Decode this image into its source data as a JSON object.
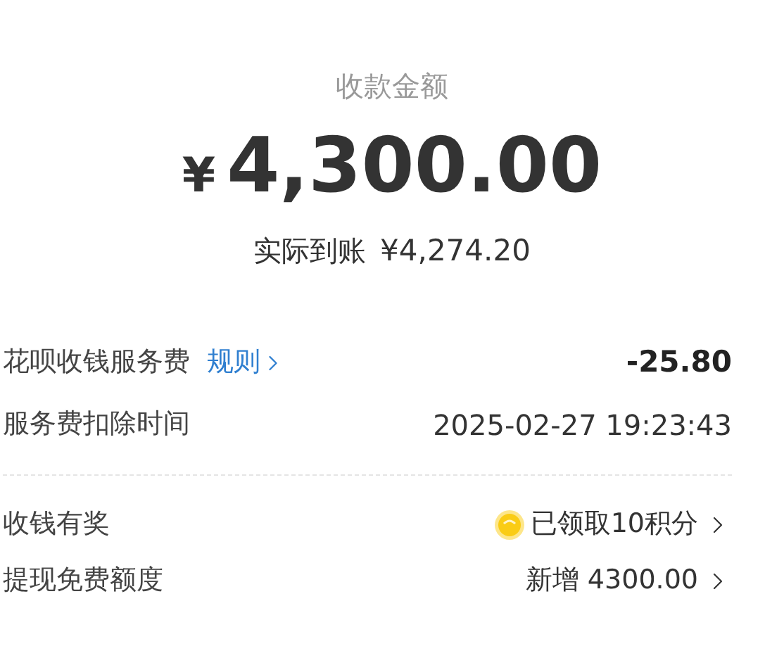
{
  "header": {
    "title": "收款金额",
    "currency": "¥",
    "amount": "4,300.00",
    "received_label": "实际到账",
    "received_amount": "¥4,274.20"
  },
  "rows": [
    {
      "kind": "fee",
      "label": "花呗收钱服务费",
      "link": "规则",
      "value": "-25.80"
    },
    {
      "kind": "plain",
      "label": "服务费扣除时间",
      "value": "2025-02-27 19:23:43"
    }
  ],
  "extras": [
    {
      "kind": "coin",
      "label": "收钱有奖",
      "value": "已领取10积分"
    },
    {
      "kind": "plain",
      "label": "提现免费额度",
      "value": "新增 4300.00"
    }
  ]
}
